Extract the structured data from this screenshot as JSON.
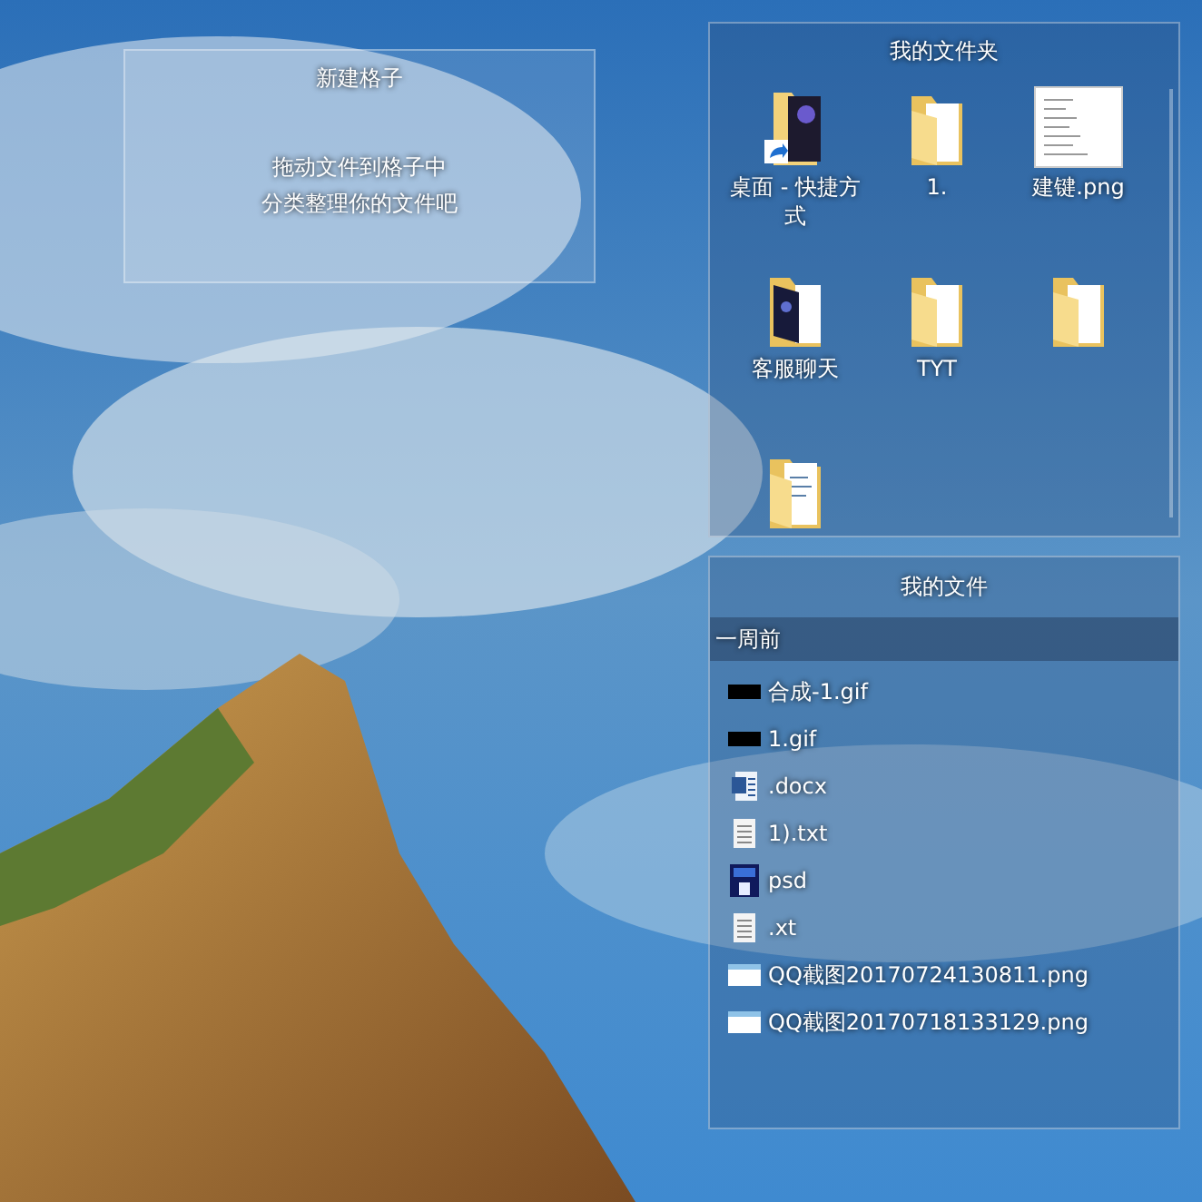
{
  "new_fence": {
    "title": "新建格子",
    "hint_lines": [
      "拖动文件到格子中",
      "分类整理你的文件吧"
    ]
  },
  "folder_fence": {
    "title": "我的文件夹",
    "items": [
      {
        "kind": "shortcut",
        "label": "桌面 - 快捷方式"
      },
      {
        "kind": "folder",
        "label": "1."
      },
      {
        "kind": "image",
        "label": "建键.png"
      },
      {
        "kind": "dark_folder",
        "label": "客服聊天"
      },
      {
        "kind": "folder",
        "label": "TYT"
      },
      {
        "kind": "folder"
      },
      {
        "kind": "doc_folder"
      }
    ]
  },
  "files_fence": {
    "title": "我的文件",
    "group": "一周前",
    "files": [
      {
        "kind": "gif",
        "name": "合成-1.gif"
      },
      {
        "kind": "gif",
        "name": "1.gif"
      },
      {
        "kind": "docx",
        "name": ".docx"
      },
      {
        "kind": "txt",
        "name": "1).txt"
      },
      {
        "kind": "psd",
        "name": "psd"
      },
      {
        "kind": "txt",
        "name": ".xt"
      },
      {
        "kind": "png",
        "name": "QQ截图20170724130811.png"
      },
      {
        "kind": "png",
        "name": "QQ截图20170718133129.png"
      }
    ]
  }
}
